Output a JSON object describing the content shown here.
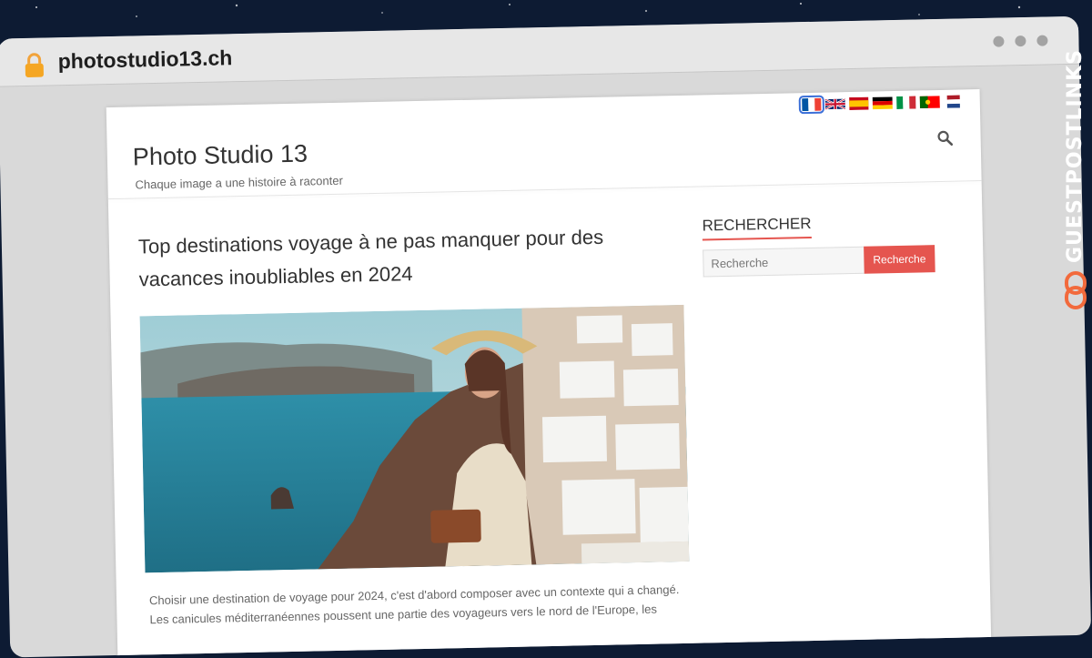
{
  "browser": {
    "url": "photostudio13.ch",
    "lock_icon": "lock-icon"
  },
  "watermark": {
    "text": "GUESTPOSTLINKS",
    "logo_icon": "chain-link-icon",
    "accent_color": "#f26a3c"
  },
  "site": {
    "title": "Photo Studio 13",
    "tagline": "Chaque image a une histoire à raconter",
    "languages": [
      {
        "code": "fr",
        "icon": "flag-france-icon",
        "selected": true
      },
      {
        "code": "en",
        "icon": "flag-uk-icon",
        "selected": false
      },
      {
        "code": "es",
        "icon": "flag-spain-icon",
        "selected": false
      },
      {
        "code": "de",
        "icon": "flag-germany-icon",
        "selected": false
      },
      {
        "code": "it",
        "icon": "flag-italy-icon",
        "selected": false
      },
      {
        "code": "pt",
        "icon": "flag-portugal-icon",
        "selected": false
      },
      {
        "code": "nl",
        "icon": "flag-netherlands-icon",
        "selected": false
      }
    ],
    "search_icon": "magnifier-icon"
  },
  "article": {
    "title": "Top destinations voyage à ne pas manquer pour des vacances inoubliables en 2024",
    "excerpt": "Choisir une destination de voyage pour 2024, c'est d'abord composer avec un contexte qui a changé. Les canicules méditerranéennes poussent une partie des voyageurs vers le nord de l'Europe, les"
  },
  "sidebar": {
    "widget_title": "RECHERCHER",
    "search_placeholder": "Recherche",
    "search_button": "Recherche"
  },
  "colors": {
    "accent": "#e5554f",
    "selected_flag_outline": "#3b6fd8"
  }
}
